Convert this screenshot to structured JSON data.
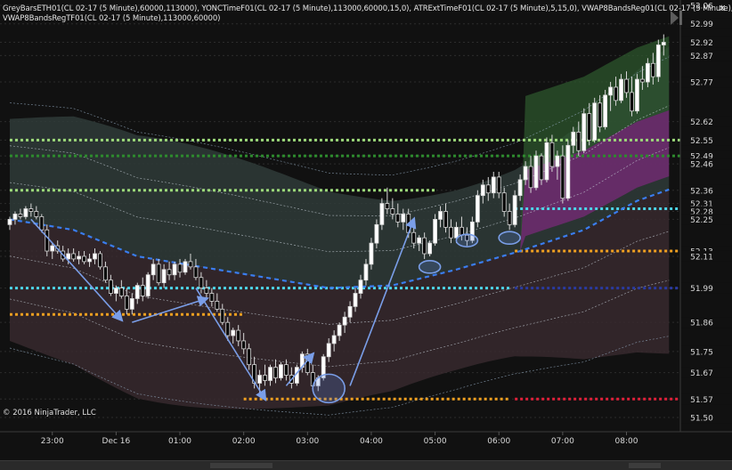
{
  "indicators": [
    "GreyBarsETH01(CL 02-17 (5 Minute),60000,113000), YONCTimeF01(CL 02-17 (5 Minute),113000,60000,15,0), ATRExtTimeF01(CL 02-17 (5 Minute),5,15,0), VWAP8BandsReg01(CL 02-17 (5 Minute),",
    "VWAP8BandsRegTF01(CL 02-17 (5 Minute),113000,60000)"
  ],
  "copyright": "© 2016 NinjaTrader, LLC",
  "close_icon": "close-icon",
  "colors": {
    "background": "#111111",
    "candle_up": "#ffffff",
    "candle_down": "#000000",
    "vwap": "#3a7df0",
    "level_green_light": "#9cd97a",
    "level_green_dark": "#2e8b2e",
    "level_cyan": "#4dd4e8",
    "level_orange": "#f0a020",
    "level_red": "#e0203a",
    "annotation": "#7a9ee8"
  },
  "chart_data": {
    "type": "candlestick",
    "instrument": "CL 02-17 (5 Minute)",
    "xlabel": "",
    "ylabel": "",
    "ylim": [
      51.49,
      53.07
    ],
    "x_ticks": [
      "23:00",
      "Dec 16",
      "01:00",
      "02:00",
      "03:00",
      "04:00",
      "05:00",
      "06:00",
      "07:00",
      "08:00"
    ],
    "y_ticks": [
      "53.06",
      "52.99",
      "52.92",
      "52.87",
      "52.77",
      "52.62",
      "52.55",
      "52.49",
      "52.46",
      "52.36",
      "52.31",
      "52.28",
      "52.25",
      "52.13",
      "52.11",
      "51.99",
      "51.86",
      "51.75",
      "51.67",
      "51.57",
      "51.50"
    ],
    "grid": true,
    "bars_per_hour": 12,
    "candles": [
      {
        "o": 52.23,
        "h": 52.26,
        "l": 52.21,
        "c": 52.25
      },
      {
        "o": 52.25,
        "h": 52.28,
        "l": 52.23,
        "c": 52.27
      },
      {
        "o": 52.27,
        "h": 52.29,
        "l": 52.25,
        "c": 52.26
      },
      {
        "o": 52.26,
        "h": 52.3,
        "l": 52.25,
        "c": 52.29
      },
      {
        "o": 52.29,
        "h": 52.31,
        "l": 52.26,
        "c": 52.28
      },
      {
        "o": 52.28,
        "h": 52.3,
        "l": 52.25,
        "c": 52.26
      },
      {
        "o": 52.26,
        "h": 52.27,
        "l": 52.2,
        "c": 52.21
      },
      {
        "o": 52.21,
        "h": 52.23,
        "l": 52.11,
        "c": 52.13
      },
      {
        "o": 52.13,
        "h": 52.16,
        "l": 52.1,
        "c": 52.15
      },
      {
        "o": 52.15,
        "h": 52.17,
        "l": 52.12,
        "c": 52.13
      },
      {
        "o": 52.13,
        "h": 52.15,
        "l": 52.09,
        "c": 52.1
      },
      {
        "o": 52.1,
        "h": 52.14,
        "l": 52.08,
        "c": 52.12
      },
      {
        "o": 52.12,
        "h": 52.14,
        "l": 52.09,
        "c": 52.1
      },
      {
        "o": 52.1,
        "h": 52.13,
        "l": 52.08,
        "c": 52.11
      },
      {
        "o": 52.11,
        "h": 52.13,
        "l": 52.08,
        "c": 52.09
      },
      {
        "o": 52.09,
        "h": 52.12,
        "l": 52.07,
        "c": 52.1
      },
      {
        "o": 52.1,
        "h": 52.14,
        "l": 52.08,
        "c": 52.12
      },
      {
        "o": 52.12,
        "h": 52.13,
        "l": 52.06,
        "c": 52.07
      },
      {
        "o": 52.07,
        "h": 52.09,
        "l": 52.01,
        "c": 52.02
      },
      {
        "o": 52.02,
        "h": 52.04,
        "l": 51.96,
        "c": 51.97
      },
      {
        "o": 51.97,
        "h": 52.0,
        "l": 51.94,
        "c": 51.99
      },
      {
        "o": 51.99,
        "h": 52.02,
        "l": 51.95,
        "c": 51.96
      },
      {
        "o": 51.96,
        "h": 51.99,
        "l": 51.89,
        "c": 51.91
      },
      {
        "o": 51.91,
        "h": 51.97,
        "l": 51.89,
        "c": 51.95
      },
      {
        "o": 51.95,
        "h": 52.01,
        "l": 51.93,
        "c": 52.0
      },
      {
        "o": 52.0,
        "h": 52.03,
        "l": 51.94,
        "c": 51.96
      },
      {
        "o": 51.96,
        "h": 52.05,
        "l": 51.95,
        "c": 52.04
      },
      {
        "o": 52.04,
        "h": 52.1,
        "l": 52.02,
        "c": 52.08
      },
      {
        "o": 52.08,
        "h": 52.1,
        "l": 52.0,
        "c": 52.01
      },
      {
        "o": 52.01,
        "h": 52.08,
        "l": 51.99,
        "c": 52.06
      },
      {
        "o": 52.06,
        "h": 52.09,
        "l": 52.02,
        "c": 52.04
      },
      {
        "o": 52.04,
        "h": 52.09,
        "l": 52.02,
        "c": 52.08
      },
      {
        "o": 52.08,
        "h": 52.1,
        "l": 52.03,
        "c": 52.05
      },
      {
        "o": 52.05,
        "h": 52.1,
        "l": 52.04,
        "c": 52.09
      },
      {
        "o": 52.09,
        "h": 52.12,
        "l": 52.06,
        "c": 52.07
      },
      {
        "o": 52.07,
        "h": 52.1,
        "l": 52.02,
        "c": 52.03
      },
      {
        "o": 52.03,
        "h": 52.05,
        "l": 51.97,
        "c": 51.99
      },
      {
        "o": 51.99,
        "h": 52.02,
        "l": 51.95,
        "c": 51.97
      },
      {
        "o": 51.97,
        "h": 51.99,
        "l": 51.92,
        "c": 51.94
      },
      {
        "o": 51.94,
        "h": 51.97,
        "l": 51.9,
        "c": 51.91
      },
      {
        "o": 51.91,
        "h": 51.93,
        "l": 51.85,
        "c": 51.86
      },
      {
        "o": 51.86,
        "h": 51.88,
        "l": 51.79,
        "c": 51.81
      },
      {
        "o": 51.81,
        "h": 51.84,
        "l": 51.78,
        "c": 51.83
      },
      {
        "o": 51.83,
        "h": 51.85,
        "l": 51.77,
        "c": 51.79
      },
      {
        "o": 51.79,
        "h": 51.82,
        "l": 51.74,
        "c": 51.76
      },
      {
        "o": 51.76,
        "h": 51.78,
        "l": 51.68,
        "c": 51.7
      },
      {
        "o": 51.7,
        "h": 51.73,
        "l": 51.61,
        "c": 51.63
      },
      {
        "o": 51.63,
        "h": 51.68,
        "l": 51.59,
        "c": 51.66
      },
      {
        "o": 51.66,
        "h": 51.7,
        "l": 51.62,
        "c": 51.64
      },
      {
        "o": 51.64,
        "h": 51.7,
        "l": 51.62,
        "c": 51.69
      },
      {
        "o": 51.69,
        "h": 51.72,
        "l": 51.63,
        "c": 51.65
      },
      {
        "o": 51.65,
        "h": 51.71,
        "l": 51.64,
        "c": 51.7
      },
      {
        "o": 51.7,
        "h": 51.72,
        "l": 51.64,
        "c": 51.66
      },
      {
        "o": 51.66,
        "h": 51.69,
        "l": 51.61,
        "c": 51.63
      },
      {
        "o": 51.63,
        "h": 51.7,
        "l": 51.62,
        "c": 51.69
      },
      {
        "o": 51.69,
        "h": 51.75,
        "l": 51.67,
        "c": 51.74
      },
      {
        "o": 51.74,
        "h": 51.76,
        "l": 51.66,
        "c": 51.67
      },
      {
        "o": 51.67,
        "h": 51.7,
        "l": 51.61,
        "c": 51.62
      },
      {
        "o": 51.62,
        "h": 51.66,
        "l": 51.6,
        "c": 51.65
      },
      {
        "o": 51.65,
        "h": 51.74,
        "l": 51.64,
        "c": 51.73
      },
      {
        "o": 51.73,
        "h": 51.8,
        "l": 51.71,
        "c": 51.78
      },
      {
        "o": 51.78,
        "h": 51.83,
        "l": 51.75,
        "c": 51.81
      },
      {
        "o": 51.81,
        "h": 51.86,
        "l": 51.79,
        "c": 51.85
      },
      {
        "o": 51.85,
        "h": 51.9,
        "l": 51.82,
        "c": 51.88
      },
      {
        "o": 51.88,
        "h": 51.94,
        "l": 51.86,
        "c": 51.92
      },
      {
        "o": 51.92,
        "h": 51.99,
        "l": 51.9,
        "c": 51.97
      },
      {
        "o": 51.97,
        "h": 52.04,
        "l": 51.95,
        "c": 52.02
      },
      {
        "o": 52.02,
        "h": 52.1,
        "l": 52.0,
        "c": 52.08
      },
      {
        "o": 52.08,
        "h": 52.18,
        "l": 52.06,
        "c": 52.16
      },
      {
        "o": 52.16,
        "h": 52.25,
        "l": 52.14,
        "c": 52.23
      },
      {
        "o": 52.23,
        "h": 52.33,
        "l": 52.21,
        "c": 52.31
      },
      {
        "o": 52.31,
        "h": 52.37,
        "l": 52.27,
        "c": 52.29
      },
      {
        "o": 52.29,
        "h": 52.33,
        "l": 52.25,
        "c": 52.27
      },
      {
        "o": 52.27,
        "h": 52.31,
        "l": 52.22,
        "c": 52.24
      },
      {
        "o": 52.24,
        "h": 52.29,
        "l": 52.21,
        "c": 52.27
      },
      {
        "o": 52.27,
        "h": 52.29,
        "l": 52.18,
        "c": 52.2
      },
      {
        "o": 52.2,
        "h": 52.22,
        "l": 52.14,
        "c": 52.16
      },
      {
        "o": 52.16,
        "h": 52.19,
        "l": 52.13,
        "c": 52.18
      },
      {
        "o": 52.18,
        "h": 52.2,
        "l": 52.1,
        "c": 52.12
      },
      {
        "o": 52.12,
        "h": 52.17,
        "l": 52.11,
        "c": 52.16
      },
      {
        "o": 52.16,
        "h": 52.27,
        "l": 52.15,
        "c": 52.25
      },
      {
        "o": 52.25,
        "h": 52.3,
        "l": 52.22,
        "c": 52.28
      },
      {
        "o": 52.28,
        "h": 52.31,
        "l": 52.2,
        "c": 52.22
      },
      {
        "o": 52.22,
        "h": 52.25,
        "l": 52.16,
        "c": 52.18
      },
      {
        "o": 52.18,
        "h": 52.24,
        "l": 52.16,
        "c": 52.22
      },
      {
        "o": 52.22,
        "h": 52.26,
        "l": 52.17,
        "c": 52.19
      },
      {
        "o": 52.19,
        "h": 52.22,
        "l": 52.15,
        "c": 52.17
      },
      {
        "o": 52.17,
        "h": 52.26,
        "l": 52.16,
        "c": 52.24
      },
      {
        "o": 52.24,
        "h": 52.36,
        "l": 52.22,
        "c": 52.34
      },
      {
        "o": 52.34,
        "h": 52.4,
        "l": 52.31,
        "c": 52.38
      },
      {
        "o": 52.38,
        "h": 52.41,
        "l": 52.32,
        "c": 52.35
      },
      {
        "o": 52.35,
        "h": 52.43,
        "l": 52.33,
        "c": 52.41
      },
      {
        "o": 52.41,
        "h": 52.43,
        "l": 52.33,
        "c": 52.35
      },
      {
        "o": 52.35,
        "h": 52.37,
        "l": 52.26,
        "c": 52.28
      },
      {
        "o": 52.28,
        "h": 52.31,
        "l": 52.21,
        "c": 52.23
      },
      {
        "o": 52.23,
        "h": 52.36,
        "l": 52.22,
        "c": 52.34
      },
      {
        "o": 52.34,
        "h": 52.42,
        "l": 52.32,
        "c": 52.4
      },
      {
        "o": 52.4,
        "h": 52.47,
        "l": 52.38,
        "c": 52.45
      },
      {
        "o": 52.45,
        "h": 52.49,
        "l": 52.35,
        "c": 52.37
      },
      {
        "o": 52.37,
        "h": 52.51,
        "l": 52.36,
        "c": 52.49
      },
      {
        "o": 52.49,
        "h": 52.5,
        "l": 52.38,
        "c": 52.4
      },
      {
        "o": 52.4,
        "h": 52.56,
        "l": 52.39,
        "c": 52.54
      },
      {
        "o": 52.54,
        "h": 52.57,
        "l": 52.43,
        "c": 52.45
      },
      {
        "o": 52.45,
        "h": 52.51,
        "l": 52.4,
        "c": 52.49
      },
      {
        "o": 52.49,
        "h": 52.53,
        "l": 52.31,
        "c": 52.33
      },
      {
        "o": 52.33,
        "h": 52.55,
        "l": 52.32,
        "c": 52.53
      },
      {
        "o": 52.53,
        "h": 52.6,
        "l": 52.5,
        "c": 52.58
      },
      {
        "o": 52.58,
        "h": 52.62,
        "l": 52.49,
        "c": 52.51
      },
      {
        "o": 52.51,
        "h": 52.67,
        "l": 52.5,
        "c": 52.65
      },
      {
        "o": 52.65,
        "h": 52.69,
        "l": 52.53,
        "c": 52.55
      },
      {
        "o": 52.55,
        "h": 52.71,
        "l": 52.54,
        "c": 52.69
      },
      {
        "o": 52.69,
        "h": 52.72,
        "l": 52.58,
        "c": 52.6
      },
      {
        "o": 52.6,
        "h": 52.74,
        "l": 52.59,
        "c": 52.72
      },
      {
        "o": 52.72,
        "h": 52.77,
        "l": 52.66,
        "c": 52.75
      },
      {
        "o": 52.75,
        "h": 52.79,
        "l": 52.68,
        "c": 52.7
      },
      {
        "o": 52.7,
        "h": 52.8,
        "l": 52.69,
        "c": 52.78
      },
      {
        "o": 52.78,
        "h": 52.81,
        "l": 52.71,
        "c": 52.73
      },
      {
        "o": 52.73,
        "h": 52.79,
        "l": 52.64,
        "c": 52.66
      },
      {
        "o": 52.66,
        "h": 52.8,
        "l": 52.65,
        "c": 52.78
      },
      {
        "o": 52.78,
        "h": 52.83,
        "l": 52.74,
        "c": 52.77
      },
      {
        "o": 52.77,
        "h": 52.86,
        "l": 52.75,
        "c": 52.84
      },
      {
        "o": 52.84,
        "h": 52.88,
        "l": 52.76,
        "c": 52.79
      },
      {
        "o": 52.79,
        "h": 52.93,
        "l": 52.77,
        "c": 52.91
      },
      {
        "o": 52.91,
        "h": 52.95,
        "l": 52.87,
        "c": 52.92
      }
    ],
    "vwap": [
      [
        0,
        52.25
      ],
      [
        12,
        52.21
      ],
      [
        24,
        52.11
      ],
      [
        36,
        52.07
      ],
      [
        48,
        52.03
      ],
      [
        60,
        51.99
      ],
      [
        72,
        52.0
      ],
      [
        84,
        52.06
      ],
      [
        96,
        52.13
      ],
      [
        108,
        52.21
      ],
      [
        118,
        52.32
      ],
      [
        125,
        52.37
      ]
    ],
    "levels": [
      {
        "price": 52.55,
        "color": "#9cd97a",
        "x0": 0,
        "x1": 125
      },
      {
        "price": 52.49,
        "color": "#2e8b2e",
        "x0": 0,
        "x1": 125
      },
      {
        "price": 52.36,
        "color": "#9cd97a",
        "x0": 0,
        "x1": 80
      },
      {
        "price": 52.29,
        "color": "#4dd4e8",
        "x0": 95,
        "x1": 125
      },
      {
        "price": 52.13,
        "color": "#f0a020",
        "x0": 95,
        "x1": 125
      },
      {
        "price": 51.99,
        "color": "#4dd4e8",
        "x0": 0,
        "x1": 94
      },
      {
        "price": 51.99,
        "color": "#2a3aa0",
        "x0": 95,
        "x1": 125
      },
      {
        "price": 51.89,
        "color": "#f0a020",
        "x0": 0,
        "x1": 44
      },
      {
        "price": 51.57,
        "color": "#f0a020",
        "x0": 44,
        "x1": 94
      },
      {
        "price": 51.57,
        "color": "#e0203a",
        "x0": 95,
        "x1": 125
      }
    ],
    "annotations": {
      "arrows": [
        [
          [
            4,
            52.25
          ],
          [
            21,
            51.87
          ]
        ],
        [
          [
            23,
            51.86
          ],
          [
            37,
            51.95
          ]
        ],
        [
          [
            35,
            51.99
          ],
          [
            48,
            51.57
          ]
        ],
        [
          [
            52,
            51.62
          ],
          [
            57,
            51.74
          ]
        ],
        [
          [
            64,
            51.62
          ],
          [
            76,
            52.25
          ]
        ]
      ],
      "ellipses": [
        [
          60,
          51.61
        ],
        [
          79,
          52.07
        ],
        [
          86,
          52.17
        ],
        [
          94,
          52.18
        ]
      ]
    }
  }
}
